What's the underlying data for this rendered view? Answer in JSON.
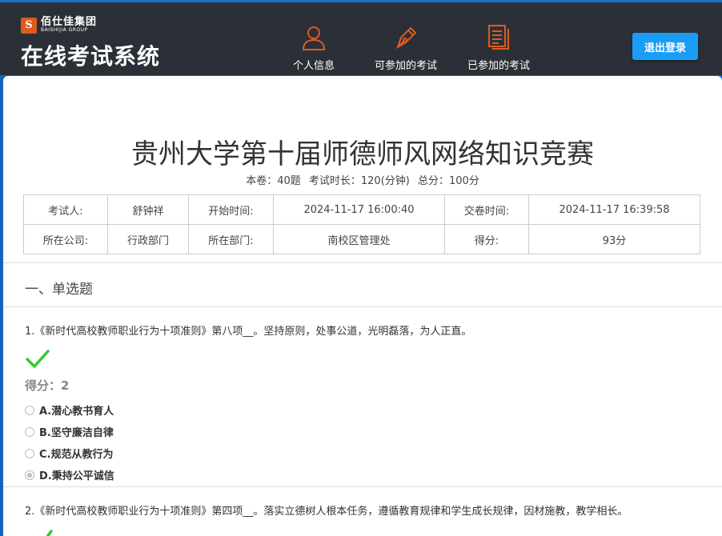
{
  "header": {
    "logo": {
      "cn": "佰仕佳集团",
      "en": "BAISHIJIA GROUP",
      "mark": "S"
    },
    "title": "在线考试系统",
    "nav": [
      {
        "label": "个人信息",
        "icon": "user-icon"
      },
      {
        "label": "可参加的考试",
        "icon": "pen-icon"
      },
      {
        "label": "已参加的考试",
        "icon": "document-icon"
      }
    ],
    "logout_label": "退出登录",
    "accent_color": "#e05a1c"
  },
  "exam": {
    "title": "贵州大学第十届师德师风网络知识竞赛",
    "meta": {
      "questions": "本卷：40题",
      "duration": "考试时长：120(分钟)",
      "total": "总分：100分"
    },
    "info": {
      "examinee_label": "考试人:",
      "examinee": "舒钟祥",
      "start_label": "开始时间:",
      "start": "2024-11-17 16:00:40",
      "submit_label": "交卷时间:",
      "submit": "2024-11-17 16:39:58",
      "company_label": "所在公司:",
      "company": "行政部门",
      "dept_label": "所在部门:",
      "dept": "南校区管理处",
      "score_label": "得分:",
      "score": "93分"
    }
  },
  "section": {
    "title": "一、单选题"
  },
  "questions": [
    {
      "text": "1.《新时代高校教师职业行为十项准则》第八项__。坚持原则，处事公道，光明磊落，为人正直。",
      "score": "得分：2",
      "options": [
        "A.潜心教书育人",
        "B.坚守廉洁自律",
        "C.规范从教行为",
        "D.秉持公平诚信"
      ],
      "selected": "D"
    },
    {
      "text": "2.《新时代高校教师职业行为十项准则》第四项__。落实立德树人根本任务，遵循教育规律和学生成长规律，因材施教，教学相长。"
    }
  ]
}
